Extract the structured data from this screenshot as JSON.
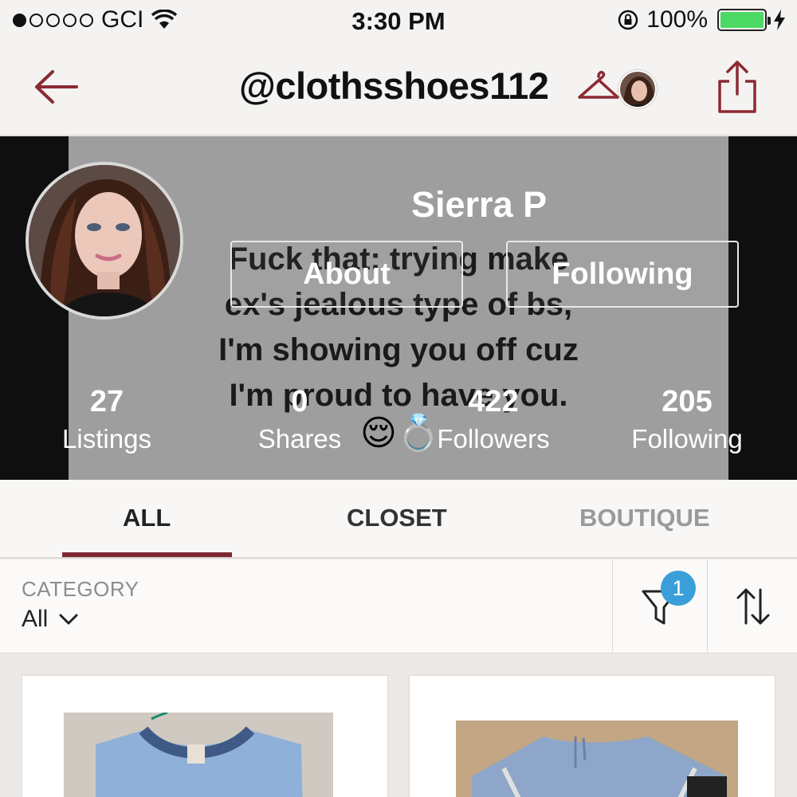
{
  "status_bar": {
    "carrier": "GCI",
    "time": "3:30 PM",
    "battery": "100%",
    "signal_bars": 1,
    "icons": [
      "wifi-icon",
      "rotation-lock-icon",
      "battery-icon",
      "charging-bolt-icon"
    ]
  },
  "nav": {
    "handle": "@clothsshoes112",
    "icons": [
      "back-arrow-icon",
      "hanger-icon",
      "share-icon"
    ]
  },
  "profile": {
    "name": "Sierra P",
    "about_label": "About",
    "following_label": "Following",
    "cover_text": [
      "Fuck that: trying make",
      "ex's jealous type of bs,",
      "I'm showing you off cuz",
      "I'm proud to have you."
    ],
    "cover_emoji": "😌💍",
    "stats": [
      {
        "value": "27",
        "label": "Listings"
      },
      {
        "value": "0",
        "label": "Shares"
      },
      {
        "value": "422",
        "label": "Followers"
      },
      {
        "value": "205",
        "label": "Following"
      }
    ]
  },
  "tabs": [
    {
      "label": "ALL",
      "active": true
    },
    {
      "label": "CLOSET",
      "active": false
    },
    {
      "label": "BOUTIQUE",
      "active": false
    }
  ],
  "filter": {
    "category_label": "CATEGORY",
    "category_value": "All",
    "filter_count": "1",
    "icons": [
      "chevron-down-icon",
      "filter-icon",
      "sort-icon"
    ]
  },
  "colors": {
    "accent": "#7c2a31",
    "badge": "#3a9fd8",
    "battery": "#4cd964"
  }
}
